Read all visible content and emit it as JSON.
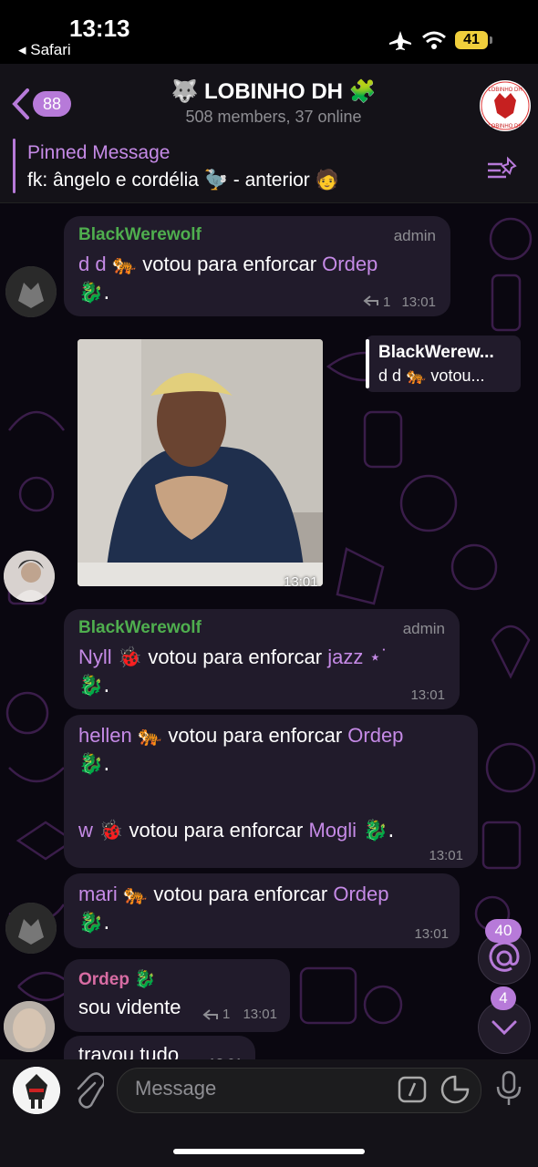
{
  "status_bar": {
    "time": "13:13",
    "back_app": "◂ Safari",
    "battery": "41"
  },
  "header": {
    "back_count": "88",
    "title": "LOBINHO DH",
    "title_emoji_left": "🐺",
    "title_emoji_right": "🧩",
    "subtitle": "508 members, 37 online",
    "avatar_text_top": "LOBINHO DH",
    "avatar_text_bottom": "LOBINHO DH"
  },
  "pinned": {
    "label": "Pinned Message",
    "text": "fk: ângelo e cordélia 🦤 - anterior 🧑"
  },
  "messages": [
    {
      "sender": "BlackWerewolf",
      "role": "admin",
      "voter": "d d",
      "voter_emoji": "🐅",
      "action": " votou para enforcar ",
      "target": "Ordep",
      "line2": "🐉.",
      "reply_count": "1",
      "time": "13:01"
    },
    {
      "time": "13:01",
      "reply_title": "BlackWerew...",
      "reply_text": "d d 🐅 votou..."
    },
    {
      "sender": "BlackWerewolf",
      "role": "admin",
      "voter": "Nyll",
      "voter_emoji": "🐞",
      "action": " votou para enforcar ",
      "target": "jazz",
      "target_suffix": " ⋆˙",
      "line2": "🐉.",
      "time": "13:01"
    },
    {
      "voter": "hellen",
      "voter_emoji": "🐅",
      "action": " votou para enforcar ",
      "target": "Ordep",
      "line2": "🐉.",
      "voter2": "w",
      "voter2_emoji": "🐞",
      "action2": " votou para enforcar ",
      "target2": "Mogli",
      "target2_suffix": " 🐉.",
      "time": "13:01"
    },
    {
      "voter": "mari",
      "voter_emoji": "🐅",
      "action": " votou para enforcar ",
      "target": "Ordep",
      "line2": "🐉.",
      "time": "13:01"
    },
    {
      "sender": "Ordep",
      "sender_emoji": "🐉",
      "text": "sou vidente",
      "reply_count": "1",
      "time": "13:01"
    },
    {
      "text": "travou tudo",
      "time": "13:01"
    }
  ],
  "floating": {
    "mentions": "40",
    "unread": "4"
  },
  "composer": {
    "placeholder": "Message"
  },
  "colors": {
    "accent": "#b77ad9",
    "admin_name": "#4fae4e",
    "ordep_name": "#d86ca3",
    "bubble": "#211b2b"
  }
}
